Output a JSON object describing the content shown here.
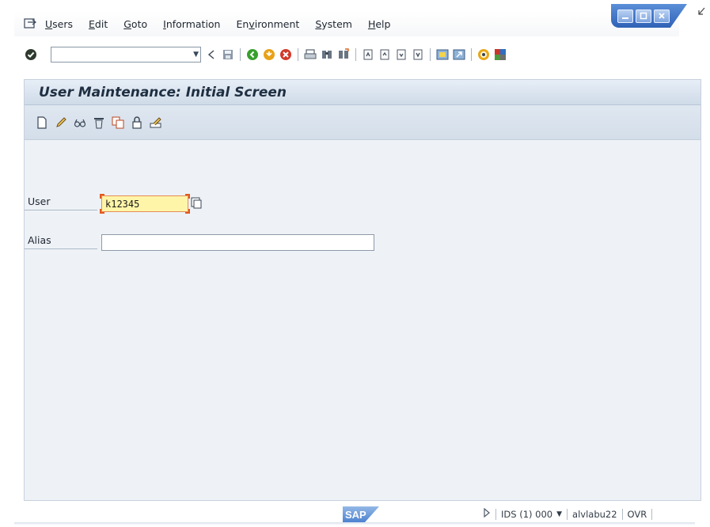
{
  "menu": {
    "items": [
      {
        "label": "Users",
        "mnemonic": "U",
        "rest": "sers"
      },
      {
        "label": "Edit",
        "mnemonic": "E",
        "rest": "dit"
      },
      {
        "label": "Goto",
        "mnemonic": "G",
        "rest": "oto"
      },
      {
        "label": "Information",
        "mnemonic": "I",
        "rest": "nformation"
      },
      {
        "label": "Environment",
        "pre": "En",
        "mnemonic": "v",
        "rest": "ironment"
      },
      {
        "label": "System",
        "pre": "",
        "mnemonic": "S",
        "rest": "ystem"
      },
      {
        "label": "Help",
        "mnemonic": "H",
        "rest": "elp"
      }
    ]
  },
  "command_field": {
    "value": ""
  },
  "page": {
    "title": "User Maintenance: Initial Screen"
  },
  "form": {
    "user_label": "User",
    "user_value": "k12345",
    "alias_label": "Alias",
    "alias_value": ""
  },
  "status": {
    "system": "IDS (1) 000",
    "user": "alvlabu22",
    "mode": "OVR",
    "logo": "SAP"
  },
  "colors": {
    "accent": "#2f62b6",
    "required_field": "#fff5a8",
    "panel_bg": "#eef2f7"
  }
}
